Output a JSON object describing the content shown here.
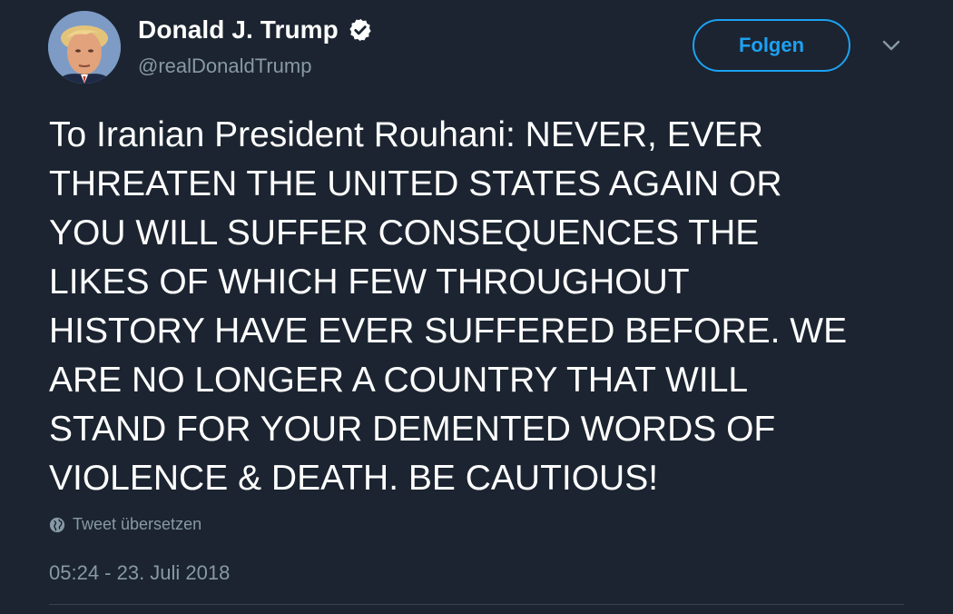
{
  "author": {
    "name": "Donald J. Trump",
    "handle": "@realDonaldTrump",
    "verified_icon": "verified-badge-icon",
    "avatar_icon": "profile-photo"
  },
  "actions": {
    "follow_label": "Folgen",
    "menu_icon": "chevron-down-icon"
  },
  "tweet": {
    "lines": [
      "To Iranian President Rouhani: NEVER, EVER",
      "THREATEN THE UNITED STATES AGAIN OR",
      "YOU WILL SUFFER CONSEQUENCES THE",
      "LIKES OF WHICH FEW THROUGHOUT",
      "HISTORY HAVE EVER SUFFERED BEFORE. WE",
      "ARE NO LONGER A COUNTRY THAT WILL",
      "STAND FOR YOUR DEMENTED WORDS OF",
      "VIOLENCE & DEATH. BE CAUTIOUS!"
    ],
    "translate_label": "Tweet übersetzen",
    "translate_icon": "globe-icon",
    "timestamp": "05:24 - 23. Juli 2018"
  },
  "colors": {
    "background": "#1b2430",
    "accent": "#1da1f2",
    "secondary_text": "#8899a6",
    "primary_text": "#ffffff"
  }
}
